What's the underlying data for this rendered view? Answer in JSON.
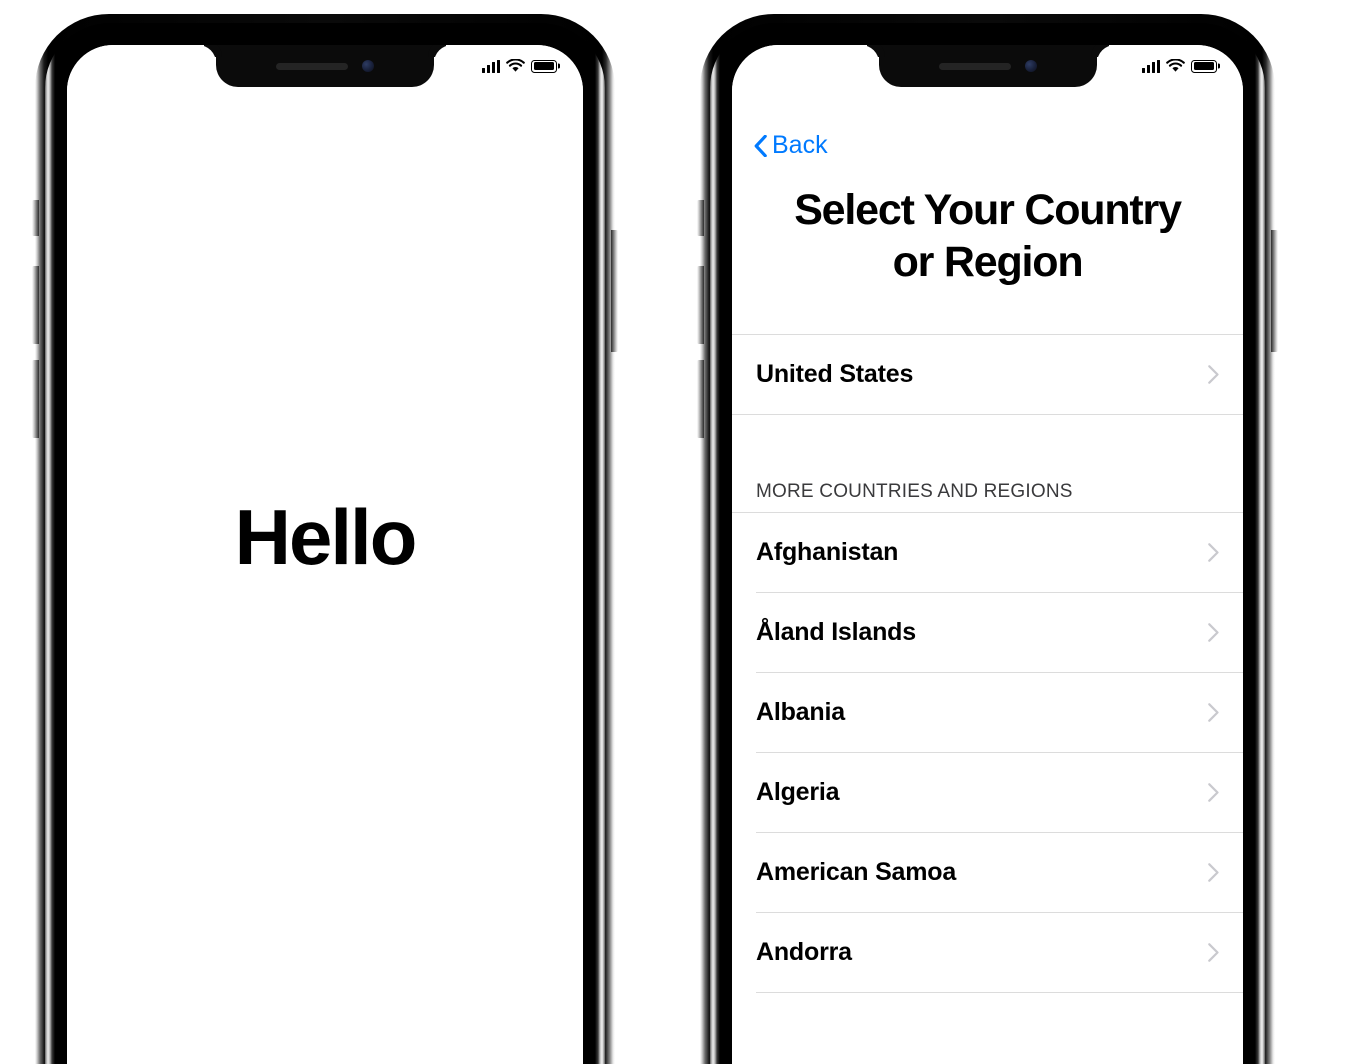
{
  "devices": {
    "left": {
      "name": "iphone-hello",
      "status_bar": {
        "signal_icon": "cellular-signal-icon",
        "wifi_icon": "wifi-icon",
        "battery_icon": "battery-icon"
      },
      "screen": {
        "greeting": "Hello"
      }
    },
    "right": {
      "name": "iphone-country-select",
      "status_bar": {
        "signal_icon": "cellular-signal-icon",
        "wifi_icon": "wifi-icon",
        "battery_icon": "battery-icon"
      },
      "screen": {
        "back_label": "Back",
        "back_icon": "chevron-left-icon",
        "title": "Select Your Country or Region",
        "title_line1": "Select Your Country",
        "title_line2": "or Region",
        "selected_section": {
          "rows": [
            {
              "label": "United States",
              "accessory_icon": "chevron-right-icon"
            }
          ]
        },
        "more_section": {
          "header": "MORE COUNTRIES AND REGIONS",
          "rows": [
            {
              "label": "Afghanistan",
              "accessory_icon": "chevron-right-icon"
            },
            {
              "label": "Åland Islands",
              "accessory_icon": "chevron-right-icon"
            },
            {
              "label": "Albania",
              "accessory_icon": "chevron-right-icon"
            },
            {
              "label": "Algeria",
              "accessory_icon": "chevron-right-icon"
            },
            {
              "label": "American Samoa",
              "accessory_icon": "chevron-right-icon"
            },
            {
              "label": "Andorra",
              "accessory_icon": "chevron-right-icon"
            }
          ]
        }
      }
    }
  },
  "colors": {
    "accent_blue": "#007AFF",
    "text_primary": "#000000",
    "separator": "#dcdcdc",
    "chevron_gray": "#c7c7cc",
    "section_header": "#3a3a3c",
    "screen_background": "#ffffff"
  }
}
